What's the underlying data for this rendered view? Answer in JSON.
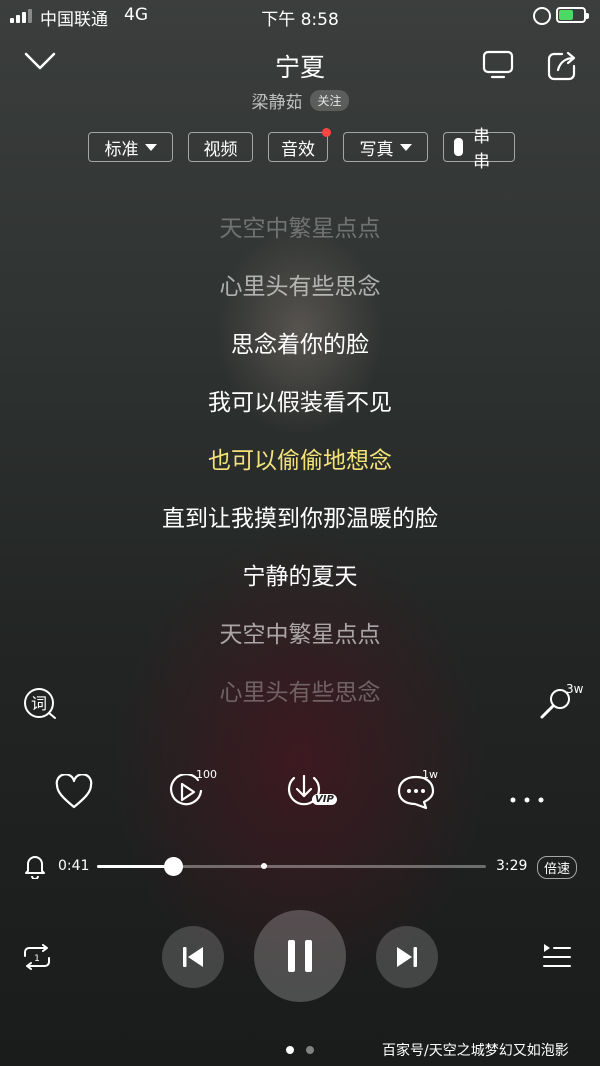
{
  "status_bar": {
    "carrier": "中国联通",
    "network": "4G",
    "time": "下午 8:58"
  },
  "song": {
    "title": "宁夏",
    "artist": "梁静茹",
    "follow_label": "关注"
  },
  "tools": {
    "quality": "标准",
    "video": "视频",
    "effects": "音效",
    "photos": "写真",
    "chuanchuan": "串串"
  },
  "lyrics": [
    {
      "text": "天空中繁星点点",
      "state": "faded"
    },
    {
      "text": "心里头有些思念",
      "state": "dim"
    },
    {
      "text": "思念着你的脸",
      "state": "normal"
    },
    {
      "text": "我可以假装看不见",
      "state": "normal"
    },
    {
      "text": "也可以偷偷地想念",
      "state": "current"
    },
    {
      "text": "直到让我摸到你那温暖的脸",
      "state": "normal"
    },
    {
      "text": "宁静的夏天",
      "state": "normal"
    },
    {
      "text": "天空中繁星点点",
      "state": "dim"
    },
    {
      "text": "心里头有些思念",
      "state": "faded"
    }
  ],
  "side": {
    "lyrics_icon_label": "词",
    "karaoke_count": "3w"
  },
  "actions": {
    "mv_count": "100",
    "vip_label": "VIP",
    "comment_count": "1w"
  },
  "progress": {
    "current": "0:41",
    "duration": "3:29",
    "played_fraction": 0.196,
    "buffered_fraction": 0.43,
    "speed_label": "倍速"
  },
  "pager": {
    "count": 2,
    "active": 0
  },
  "watermark": "百家号/天空之城梦幻又如泡影",
  "colors": {
    "current_lyric": "#f3e27a",
    "normal_lyric": "#ffffff",
    "dim_lyric": "rgba(255,255,255,0.6)",
    "faded_lyric": "rgba(255,255,255,0.3)"
  }
}
